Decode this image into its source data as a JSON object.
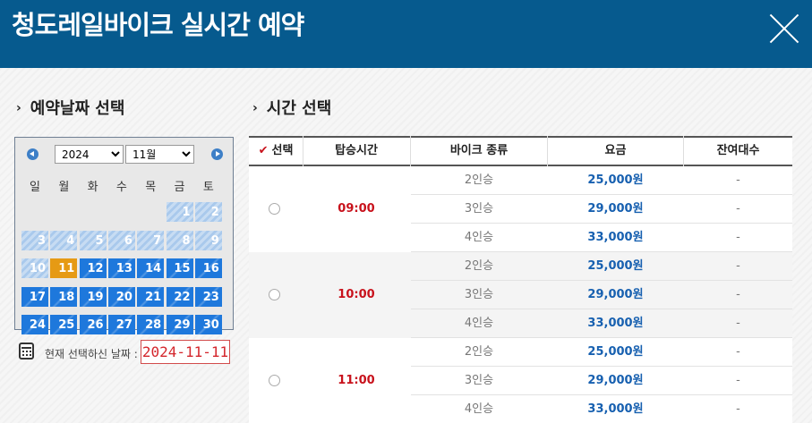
{
  "header": {
    "title": "청도레일바이크 실시간 예약"
  },
  "date_section": {
    "title": "예약날짜 선택"
  },
  "time_section": {
    "title": "시간 선택"
  },
  "calendar": {
    "year": "2024",
    "month": "11월",
    "weekdays": [
      "일",
      "월",
      "화",
      "수",
      "목",
      "금",
      "토"
    ],
    "weeks": [
      [
        null,
        null,
        null,
        null,
        null,
        "1",
        "2"
      ],
      [
        "3",
        "4",
        "5",
        "6",
        "7",
        "8",
        "9"
      ],
      [
        "10",
        "11",
        "12",
        "13",
        "14",
        "15",
        "16"
      ],
      [
        "17",
        "18",
        "19",
        "20",
        "21",
        "22",
        "23"
      ],
      [
        "24",
        "25",
        "26",
        "27",
        "28",
        "29",
        "30"
      ]
    ],
    "past_days": [
      "1",
      "2",
      "3",
      "4",
      "5",
      "6",
      "7",
      "8",
      "9",
      "10"
    ],
    "today": "11"
  },
  "selected": {
    "label": "현재 선택하신 날짜 :",
    "value": "2024-11-11"
  },
  "table": {
    "headers": {
      "select": "선택",
      "time": "탑승시간",
      "type": "바이크 종류",
      "fee": "요금",
      "remaining": "잔여대수"
    },
    "groups": [
      {
        "time": "09:00",
        "rows": [
          {
            "type": "2인승",
            "fee": "25,000원",
            "remaining": "-"
          },
          {
            "type": "3인승",
            "fee": "29,000원",
            "remaining": "-"
          },
          {
            "type": "4인승",
            "fee": "33,000원",
            "remaining": "-"
          }
        ]
      },
      {
        "time": "10:00",
        "rows": [
          {
            "type": "2인승",
            "fee": "25,000원",
            "remaining": "-"
          },
          {
            "type": "3인승",
            "fee": "29,000원",
            "remaining": "-"
          },
          {
            "type": "4인승",
            "fee": "33,000원",
            "remaining": "-"
          }
        ]
      },
      {
        "time": "11:00",
        "rows": [
          {
            "type": "2인승",
            "fee": "25,000원",
            "remaining": "-"
          },
          {
            "type": "3인승",
            "fee": "29,000원",
            "remaining": "-"
          },
          {
            "type": "4인승",
            "fee": "33,000원",
            "remaining": "-"
          }
        ]
      }
    ]
  },
  "colors": {
    "header_bg": "#065a8e",
    "available_day": "#1e78dc",
    "today": "#e69a14",
    "past_day": "#a9c9ec",
    "time_text": "#c8121c",
    "fee_text": "#1760b0"
  }
}
